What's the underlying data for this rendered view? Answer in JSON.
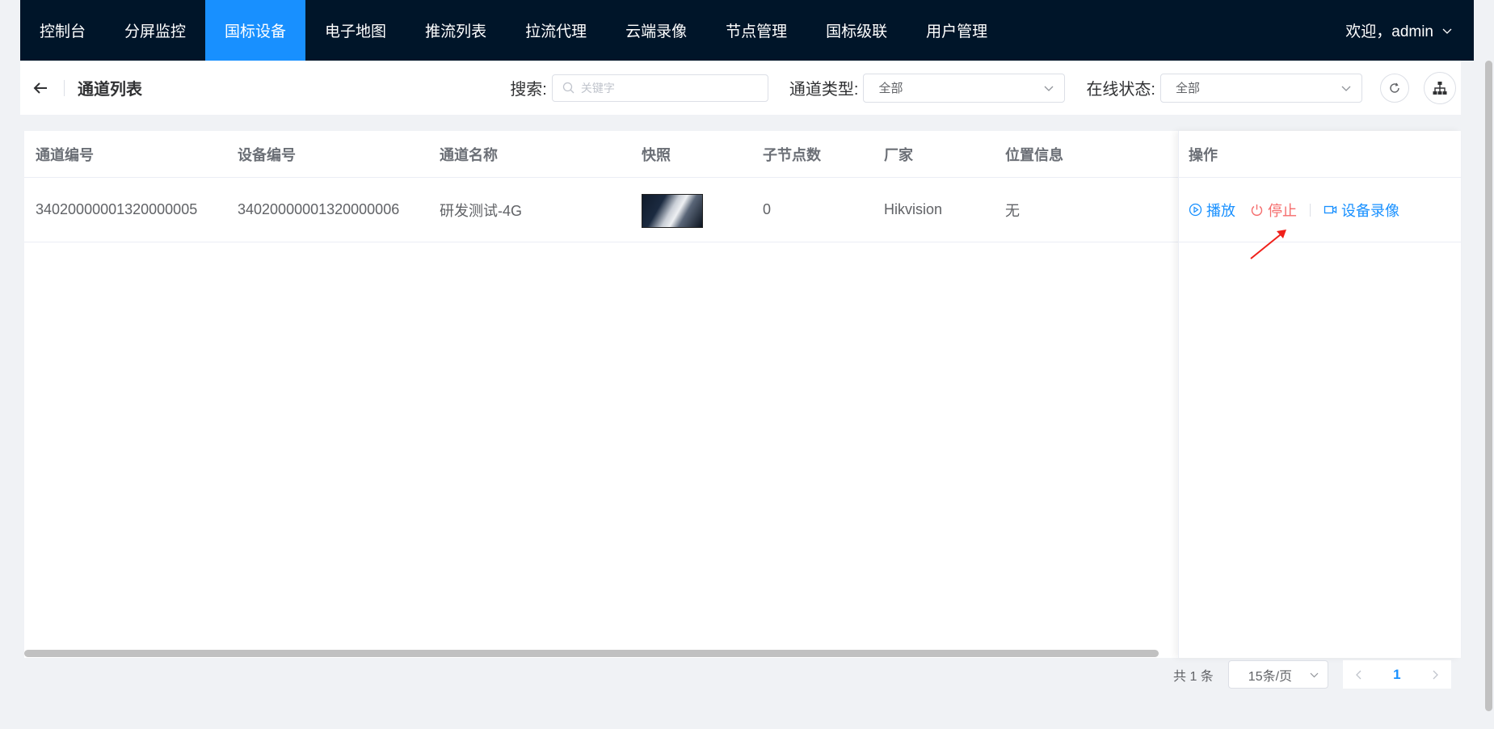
{
  "nav": {
    "items": [
      {
        "label": "控制台",
        "active": false
      },
      {
        "label": "分屏监控",
        "active": false
      },
      {
        "label": "国标设备",
        "active": true
      },
      {
        "label": "电子地图",
        "active": false
      },
      {
        "label": "推流列表",
        "active": false
      },
      {
        "label": "拉流代理",
        "active": false
      },
      {
        "label": "云端录像",
        "active": false
      },
      {
        "label": "节点管理",
        "active": false
      },
      {
        "label": "国标级联",
        "active": false
      },
      {
        "label": "用户管理",
        "active": false
      }
    ],
    "welcome": "欢迎，admin"
  },
  "header": {
    "title": "通道列表",
    "search_label": "搜索:",
    "search_placeholder": "关键字",
    "type_label": "通道类型:",
    "type_value": "全部",
    "status_label": "在线状态:",
    "status_value": "全部"
  },
  "table": {
    "columns": [
      "通道编号",
      "设备编号",
      "通道名称",
      "快照",
      "子节点数",
      "厂家",
      "位置信息",
      "操作"
    ],
    "rows": [
      {
        "channel_id": "34020000001320000005",
        "device_id": "34020000001320000006",
        "name": "研发测试-4G",
        "children": "0",
        "vendor": "Hikvision",
        "location": "无",
        "actions": {
          "play": "播放",
          "stop": "停止",
          "record": "设备录像"
        }
      }
    ]
  },
  "pagination": {
    "total": "共 1 条",
    "page_size": "15条/页",
    "current": "1"
  },
  "colors": {
    "nav_bg": "#001529",
    "accent": "#1890ff",
    "danger": "#f56c6c"
  }
}
